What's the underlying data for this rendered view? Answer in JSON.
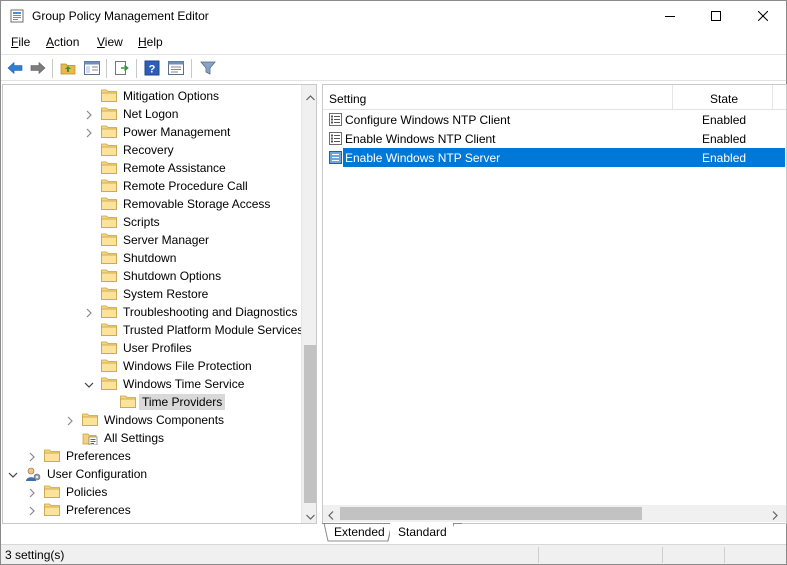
{
  "window": {
    "title": "Group Policy Management Editor"
  },
  "menu": [
    {
      "label": "File",
      "key": "F",
      "rest": "ile"
    },
    {
      "label": "Action",
      "key": "A",
      "rest": "ction"
    },
    {
      "label": "View",
      "key": "V",
      "rest": "iew"
    },
    {
      "label": "Help",
      "key": "H",
      "rest": "elp"
    }
  ],
  "toolbar": [
    "back-icon",
    "forward-icon",
    "up-folder-icon",
    "show-hide-tree-icon",
    "export-list-icon",
    "help-icon",
    "properties-icon",
    "filter-icon"
  ],
  "tree": [
    {
      "label": "Mitigation Options",
      "expander": "none"
    },
    {
      "label": "Net Logon",
      "expander": "collapsed"
    },
    {
      "label": "Power Management",
      "expander": "collapsed"
    },
    {
      "label": "Recovery",
      "expander": "none"
    },
    {
      "label": "Remote Assistance",
      "expander": "none"
    },
    {
      "label": "Remote Procedure Call",
      "expander": "none"
    },
    {
      "label": "Removable Storage Access",
      "expander": "none"
    },
    {
      "label": "Scripts",
      "expander": "none"
    },
    {
      "label": "Server Manager",
      "expander": "none"
    },
    {
      "label": "Shutdown",
      "expander": "none"
    },
    {
      "label": "Shutdown Options",
      "expander": "none"
    },
    {
      "label": "System Restore",
      "expander": "none"
    },
    {
      "label": "Troubleshooting and Diagnostics",
      "expander": "collapsed"
    },
    {
      "label": "Trusted Platform Module Services",
      "expander": "none"
    },
    {
      "label": "User Profiles",
      "expander": "none"
    },
    {
      "label": "Windows File Protection",
      "expander": "none"
    },
    {
      "label": "Windows Time Service",
      "expander": "expanded"
    },
    {
      "label": "Time Providers",
      "expander": "none",
      "selected": true
    },
    {
      "label": "Windows Components",
      "expander": "collapsed"
    },
    {
      "label": "All Settings",
      "expander": "none",
      "icon": "all-settings-icon"
    },
    {
      "label": "Preferences",
      "expander": "collapsed"
    },
    {
      "label": "User Configuration",
      "expander": "expanded",
      "icon": "user-config-icon"
    },
    {
      "label": "Policies",
      "expander": "collapsed"
    },
    {
      "label": "Preferences",
      "expander": "collapsed"
    }
  ],
  "list": {
    "columns": {
      "setting": "Setting",
      "state": "State"
    },
    "rows": [
      {
        "name": "Configure Windows NTP Client",
        "state": "Enabled"
      },
      {
        "name": "Enable Windows NTP Client",
        "state": "Enabled"
      },
      {
        "name": "Enable Windows NTP Server",
        "state": "Enabled",
        "selected": true
      }
    ]
  },
  "tabs": {
    "extended": "Extended",
    "standard": "Standard",
    "active": "standard"
  },
  "status": {
    "text": "3 setting(s)"
  }
}
